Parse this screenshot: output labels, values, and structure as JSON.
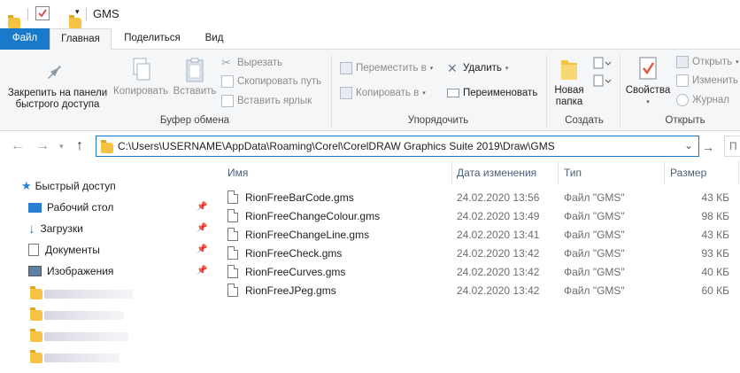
{
  "window": {
    "title": "GMS"
  },
  "tabs": [
    "Файл",
    "Главная",
    "Поделиться",
    "Вид"
  ],
  "ribbon": {
    "clipboard": {
      "pin_label_1": "Закрепить на панели",
      "pin_label_2": "быстрого доступа",
      "copy": "Копировать",
      "paste": "Вставить",
      "cut": "Вырезать",
      "copy_path": "Скопировать путь",
      "paste_shortcut": "Вставить ярлык",
      "title": "Буфер обмена"
    },
    "organize": {
      "move_to": "Переместить в",
      "copy_to": "Копировать в",
      "delete": "Удалить",
      "rename": "Переименовать",
      "title": "Упорядочить"
    },
    "new": {
      "new_folder_1": "Новая",
      "new_folder_2": "папка",
      "title": "Создать"
    },
    "open": {
      "properties": "Свойства",
      "open": "Открыть",
      "edit": "Изменить",
      "history": "Журнал",
      "title": "Открыть"
    }
  },
  "address": {
    "path": "C:\\Users\\USERNAME\\AppData\\Roaming\\Corel\\CorelDRAW Graphics Suite 2019\\Draw\\GMS",
    "search_stub": "П"
  },
  "nav": {
    "quick_access": "Быстрый доступ",
    "items": [
      "Рабочий стол",
      "Загрузки",
      "Документы",
      "Изображения"
    ]
  },
  "columns": {
    "name": "Имя",
    "date": "Дата изменения",
    "type": "Тип",
    "size": "Размер"
  },
  "files": [
    {
      "name": "RionFreeBarCode.gms",
      "date": "24.02.2020 13:56",
      "type": "Файл \"GMS\"",
      "size": "43 КБ"
    },
    {
      "name": "RionFreeChangeColour.gms",
      "date": "24.02.2020 13:49",
      "type": "Файл \"GMS\"",
      "size": "98 КБ"
    },
    {
      "name": "RionFreeChangeLine.gms",
      "date": "24.02.2020 13:41",
      "type": "Файл \"GMS\"",
      "size": "43 КБ"
    },
    {
      "name": "RionFreeCheck.gms",
      "date": "24.02.2020 13:42",
      "type": "Файл \"GMS\"",
      "size": "93 КБ"
    },
    {
      "name": "RionFreeCurves.gms",
      "date": "24.02.2020 13:42",
      "type": "Файл \"GMS\"",
      "size": "40 КБ"
    },
    {
      "name": "RionFreeJPeg.gms",
      "date": "24.02.2020 13:42",
      "type": "Файл \"GMS\"",
      "size": "60 КБ"
    }
  ],
  "colors": {
    "accent": "#1979ca",
    "folder": "#f5c342"
  }
}
